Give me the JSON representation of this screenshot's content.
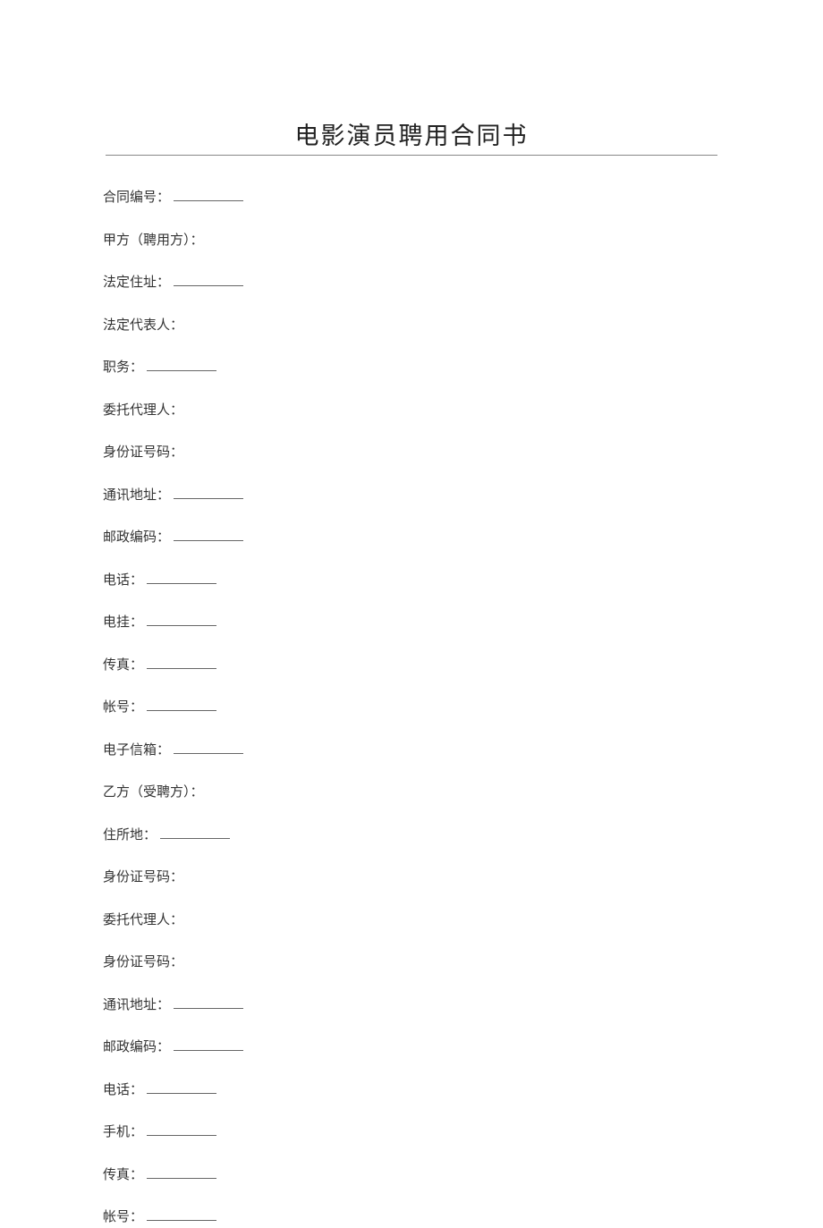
{
  "doc": {
    "title": "电影演员聘用合同书",
    "fields": [
      {
        "label": "合同编号：",
        "blank": true
      },
      {
        "label": "甲方（聘用方）：",
        "blank": false
      },
      {
        "label": "法定住址：",
        "blank": true
      },
      {
        "label": "法定代表人：",
        "blank": false
      },
      {
        "label": "职务：",
        "blank": true
      },
      {
        "label": "委托代理人：",
        "blank": false
      },
      {
        "label": "身份证号码：",
        "blank": false
      },
      {
        "label": "通讯地址：",
        "blank": true
      },
      {
        "label": "邮政编码：",
        "blank": true
      },
      {
        "label": "电话：",
        "blank": true
      },
      {
        "label": "电挂：",
        "blank": true
      },
      {
        "label": "传真：",
        "blank": true
      },
      {
        "label": "帐号：",
        "blank": true
      },
      {
        "label": "电子信箱：",
        "blank": true
      },
      {
        "label": "乙方（受聘方）：",
        "blank": false
      },
      {
        "label": "住所地：",
        "blank": true
      },
      {
        "label": "身份证号码：",
        "blank": false
      },
      {
        "label": "委托代理人：",
        "blank": false
      },
      {
        "label": "身份证号码：",
        "blank": false
      },
      {
        "label": "通讯地址：",
        "blank": true
      },
      {
        "label": "邮政编码：",
        "blank": true
      },
      {
        "label": "电话：",
        "blank": true
      },
      {
        "label": "手机：",
        "blank": true
      },
      {
        "label": "传真：",
        "blank": true
      },
      {
        "label": "帐号：",
        "blank": true
      }
    ]
  }
}
